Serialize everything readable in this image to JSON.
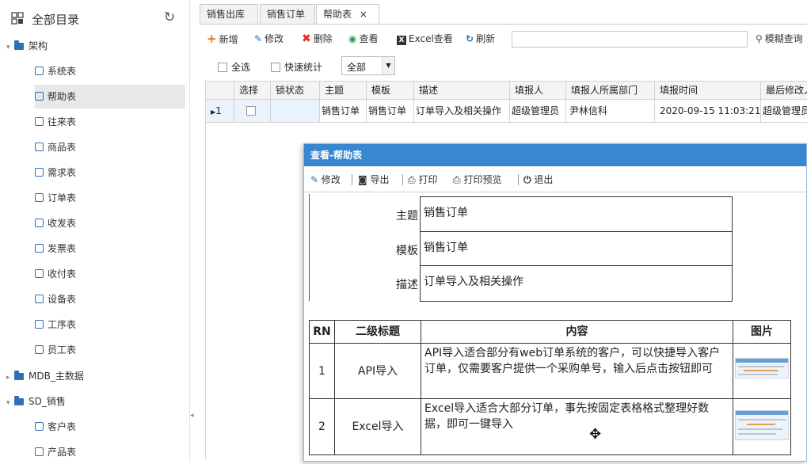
{
  "sidebar": {
    "title": "全部目录",
    "refresh_icon": "refresh-icon",
    "items": [
      {
        "label": "架构",
        "type": "folder",
        "expanded": true
      },
      {
        "label": "系统表",
        "type": "item"
      },
      {
        "label": "帮助表",
        "type": "item",
        "selected": true
      },
      {
        "label": "往来表",
        "type": "item"
      },
      {
        "label": "商品表",
        "type": "item"
      },
      {
        "label": "需求表",
        "type": "item"
      },
      {
        "label": "订单表",
        "type": "item"
      },
      {
        "label": "收发表",
        "type": "item"
      },
      {
        "label": "发票表",
        "type": "item"
      },
      {
        "label": "收付表",
        "type": "item"
      },
      {
        "label": "设备表",
        "type": "item"
      },
      {
        "label": "工序表",
        "type": "item"
      },
      {
        "label": "员工表",
        "type": "item"
      },
      {
        "label": "MDB_主数据",
        "type": "folder",
        "expanded": false
      },
      {
        "label": "SD_销售",
        "type": "folder",
        "expanded": true
      },
      {
        "label": "客户表",
        "type": "item"
      },
      {
        "label": "产品表",
        "type": "item"
      }
    ]
  },
  "tabs": [
    {
      "label": "销售出库"
    },
    {
      "label": "销售订单"
    },
    {
      "label": "帮助表",
      "active": true,
      "close": "×"
    }
  ],
  "toolbar": {
    "add": "新增",
    "edit": "修改",
    "delete": "删除",
    "view": "查看",
    "excel_view": "Excel查看",
    "refresh": "刷新",
    "search_value": "",
    "fuzzy_query": "模糊查询"
  },
  "filters": {
    "select_all": "全选",
    "quick_stats": "快速统计",
    "status_value": "全部"
  },
  "grid": {
    "columns": [
      "",
      "选择",
      "锁状态",
      "主题",
      "模板",
      "描述",
      "填报人",
      "填报人所属部门",
      "填报时间",
      "最后修改人"
    ],
    "rows": [
      {
        "rn": "1",
        "selected": false,
        "lock": "",
        "subject": "销售订单",
        "template": "销售订单",
        "desc": "订单导入及相关操作",
        "reporter": "超级管理员",
        "dept": "尹林信科",
        "time": "2020-09-15 11:03:21",
        "last_modifier": "超级管理员"
      }
    ]
  },
  "dialog": {
    "title": "查看-帮助表",
    "toolbar": {
      "edit": "修改",
      "export": "导出",
      "print": "打印",
      "print_preview": "打印预览",
      "exit": "退出"
    },
    "fields": {
      "subject_label": "主题",
      "subject_value": "销售订单",
      "template_label": "模板",
      "template_value": "销售订单",
      "desc_label": "描述",
      "desc_value": "订单导入及相关操作"
    },
    "table": {
      "headers": [
        "RN",
        "二级标题",
        "内容",
        "图片"
      ],
      "rows": [
        {
          "rn": "1",
          "subtitle": "API导入",
          "content": "API导入适合部分有web订单系统的客户，可以快捷导入客户订单，仅需要客户提供一个采购单号，输入后点击按钮即可"
        },
        {
          "rn": "2",
          "subtitle": "Excel导入",
          "content": "Excel导入适合大部分订单，事先按固定表格格式整理好数据，即可一键导入"
        }
      ]
    }
  },
  "colors": {
    "accent": "#3a87d1",
    "folder": "#2f6fb3",
    "add": "#e8710a",
    "delete": "#d9302a",
    "view": "#2e9d5a"
  }
}
